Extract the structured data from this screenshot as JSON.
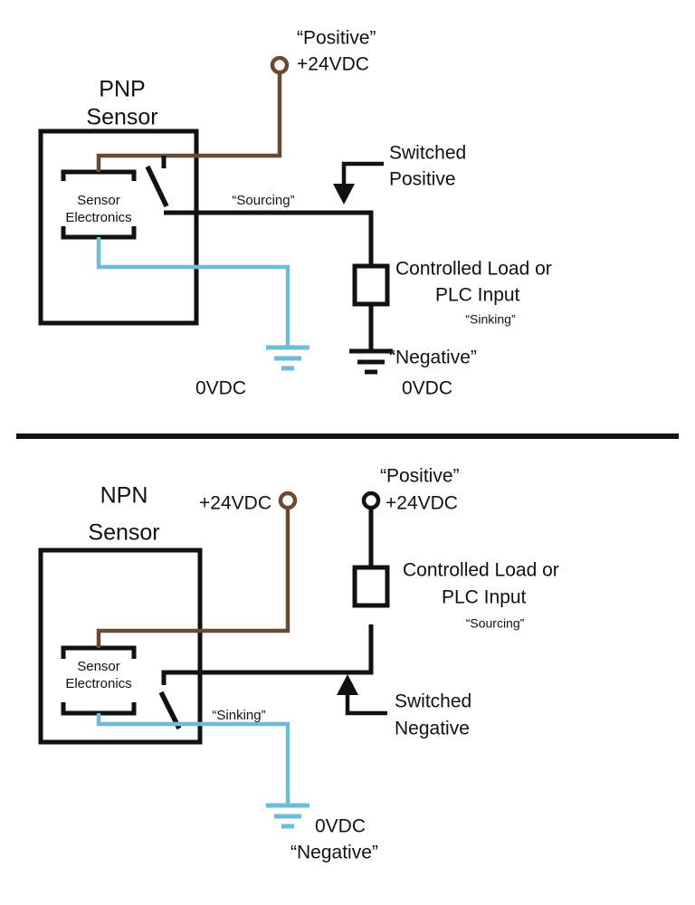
{
  "figure": {
    "title": "PNP vs NPN sensor wiring diagram",
    "colors": {
      "wire_positive_brown": "#6B4A33",
      "wire_negative_blue": "#6DBCD8",
      "wire_signal_black": "#111111",
      "background": "#FFFFFF"
    }
  },
  "pnp": {
    "sensor_title_line1": "PNP",
    "sensor_title_line2": "Sensor",
    "electronics_line1": "Sensor",
    "electronics_line2": "Electronics",
    "supply_quote": "“Positive”",
    "supply_voltage": "+24VDC",
    "switched_line1": "Switched",
    "switched_line2": "Positive",
    "sourcing_label": "“Sourcing”",
    "load_line1": "Controlled Load or",
    "load_line2": "PLC Input",
    "load_mode": "“Sinking”",
    "return_quote": "“Negative”",
    "return_voltage": "0VDC",
    "sensor_ground_voltage": "0VDC"
  },
  "npn": {
    "sensor_title_line1": "NPN",
    "sensor_title_line2": "Sensor",
    "electronics_line1": "Sensor",
    "electronics_line2": "Electronics",
    "supply_voltage": "+24VDC",
    "load_supply_quote": "“Positive”",
    "load_supply_voltage": "+24VDC",
    "load_line1": "Controlled Load or",
    "load_line2": "PLC Input",
    "load_mode": "“Sourcing”",
    "sinking_label": "“Sinking”",
    "switched_line1": "Switched",
    "switched_line2": "Negative",
    "ground_voltage": "0VDC",
    "ground_quote": "“Negative”"
  }
}
